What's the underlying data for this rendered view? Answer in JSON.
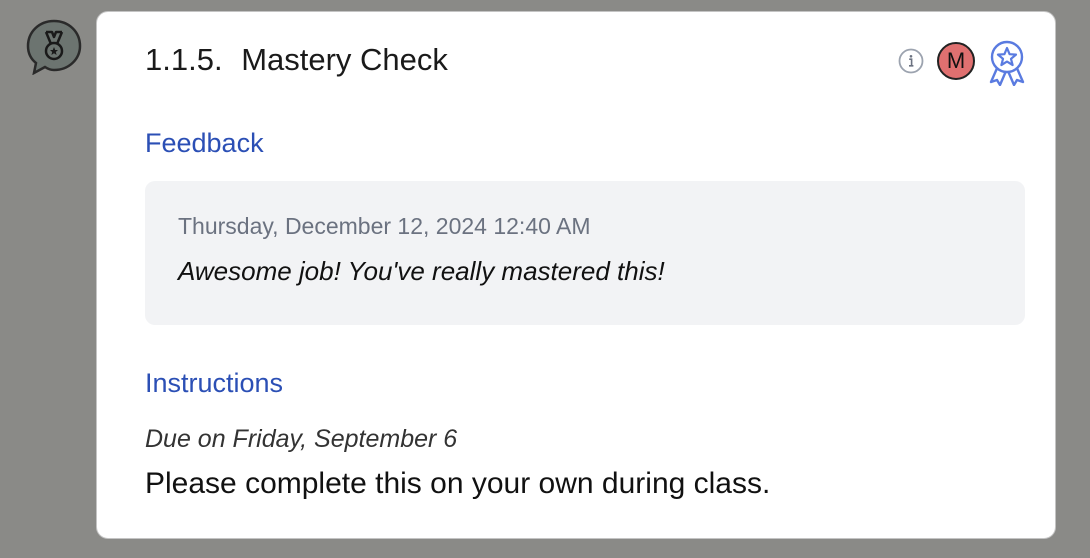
{
  "assignment": {
    "number": "1.1.5.",
    "title": "Mastery Check"
  },
  "header": {
    "info_icon": "info-icon",
    "avatar_initial": "M",
    "avatar_color": "#e07070",
    "award_icon": "award-ribbon-icon"
  },
  "side_badge_icon": "medal-chat-icon",
  "feedback": {
    "label": "Feedback",
    "date": "Thursday, December 12, 2024 12:40 AM",
    "message": "Awesome job! You've really mastered this!"
  },
  "instructions": {
    "label": "Instructions",
    "due": "Due on Friday, September 6",
    "text": "Please complete this on your own during class."
  },
  "colors": {
    "accent": "#2b4fb5",
    "backdrop": "#8a8a87",
    "feedback_bg": "#f2f3f5"
  }
}
